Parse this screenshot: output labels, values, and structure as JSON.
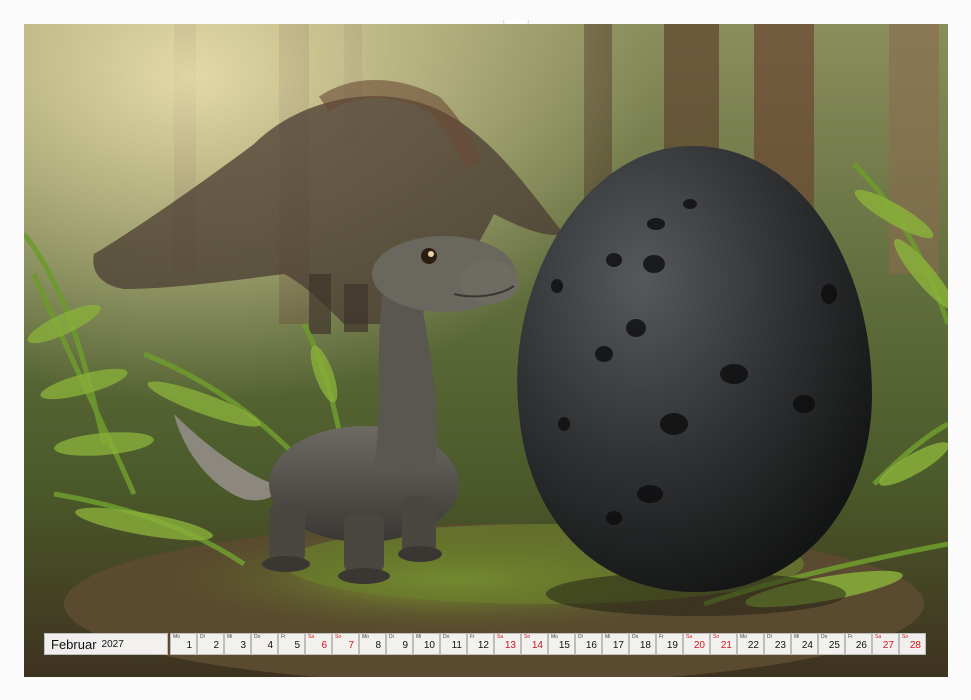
{
  "photo": {
    "description_icon": "dinosaur-photo"
  },
  "calendar": {
    "month": "Februar",
    "year": "2027",
    "days": [
      {
        "wd": "Mo",
        "n": "1",
        "weekend": false
      },
      {
        "wd": "Di",
        "n": "2",
        "weekend": false
      },
      {
        "wd": "Mi",
        "n": "3",
        "weekend": false
      },
      {
        "wd": "Do",
        "n": "4",
        "weekend": false
      },
      {
        "wd": "Fr",
        "n": "5",
        "weekend": false
      },
      {
        "wd": "Sa",
        "n": "6",
        "weekend": true
      },
      {
        "wd": "So",
        "n": "7",
        "weekend": true
      },
      {
        "wd": "Mo",
        "n": "8",
        "weekend": false
      },
      {
        "wd": "Di",
        "n": "9",
        "weekend": false
      },
      {
        "wd": "Mi",
        "n": "10",
        "weekend": false
      },
      {
        "wd": "Do",
        "n": "11",
        "weekend": false
      },
      {
        "wd": "Fr",
        "n": "12",
        "weekend": false
      },
      {
        "wd": "Sa",
        "n": "13",
        "weekend": true
      },
      {
        "wd": "So",
        "n": "14",
        "weekend": true
      },
      {
        "wd": "Mo",
        "n": "15",
        "weekend": false
      },
      {
        "wd": "Di",
        "n": "16",
        "weekend": false
      },
      {
        "wd": "Mi",
        "n": "17",
        "weekend": false
      },
      {
        "wd": "Do",
        "n": "18",
        "weekend": false
      },
      {
        "wd": "Fr",
        "n": "19",
        "weekend": false
      },
      {
        "wd": "Sa",
        "n": "20",
        "weekend": true
      },
      {
        "wd": "So",
        "n": "21",
        "weekend": true
      },
      {
        "wd": "Mo",
        "n": "22",
        "weekend": false
      },
      {
        "wd": "Di",
        "n": "23",
        "weekend": false
      },
      {
        "wd": "Mi",
        "n": "24",
        "weekend": false
      },
      {
        "wd": "Do",
        "n": "25",
        "weekend": false
      },
      {
        "wd": "Fr",
        "n": "26",
        "weekend": false
      },
      {
        "wd": "Sa",
        "n": "27",
        "weekend": true
      },
      {
        "wd": "So",
        "n": "28",
        "weekend": true
      }
    ]
  },
  "colors": {
    "weekend": "#d2141e",
    "text": "#111111"
  }
}
